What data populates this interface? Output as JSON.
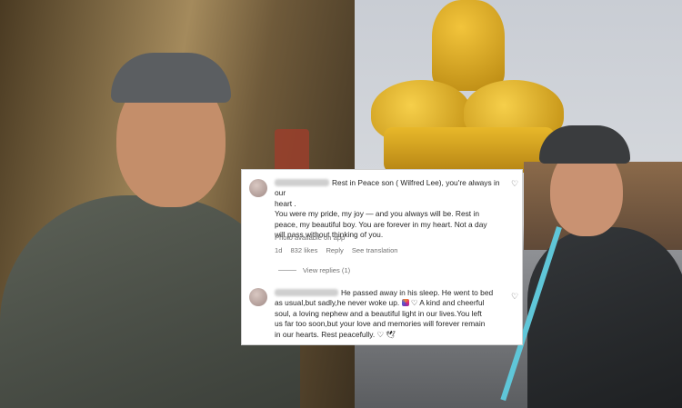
{
  "comments": [
    {
      "username_hidden": true,
      "text_line1": "Rest in Peace son ( Wilfred Lee), you're always in our",
      "text_line2": "heart .",
      "text_line3": "You were my pride, my joy — and you always will be. Rest in",
      "text_line4": "peace, my beautiful boy. You are forever in my heart. Not a day",
      "text_line5": "will pass without thinking of you.",
      "photo_note": "Photo available on app",
      "age": "1d",
      "likes": "832 likes",
      "reply_label": "Reply",
      "translate_label": "See translation",
      "view_replies": "View replies (1)",
      "like_icon": "heart-outline-icon"
    },
    {
      "username_hidden": true,
      "text_line1": "He passed away in his sleep. He went to bed",
      "text_line2": "as usual,but sadly,he never woke up.",
      "text_line2b": "A kind and cheerful",
      "text_line3": "soul, a loving nephew and a beautiful light in our lives.You left",
      "text_line4": "us far too soon,but your love and memories will forever remain",
      "text_line5": "in our hearts. Rest peacefully.",
      "like_icon": "heart-outline-icon"
    }
  ],
  "glyphs": {
    "heart": "♡",
    "dove": "🕊"
  },
  "colors": {
    "text": "#262626",
    "muted": "#737373",
    "card_bg": "#ffffff"
  }
}
